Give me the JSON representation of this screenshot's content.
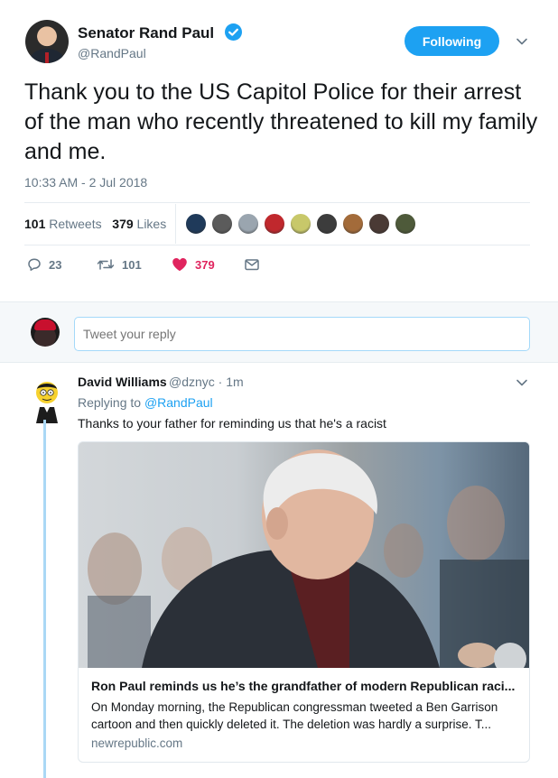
{
  "tweet": {
    "author_name": "Senator Rand Paul",
    "author_handle": "@RandPaul",
    "follow_label": "Following",
    "text": "Thank you to the US Capitol Police for their arrest of the man who recently threatened to kill my family and me.",
    "timestamp": "10:33 AM - 2 Jul 2018",
    "stats": {
      "retweets_count": "101",
      "retweets_label": "Retweets",
      "likes_count": "379",
      "likes_label": "Likes"
    },
    "liker_avatar_colors": [
      "#1f3a5a",
      "#5b5b5b",
      "#9aa5af",
      "#c0282d",
      "#c8c86a",
      "#3c3c3c",
      "#a36b3a",
      "#4a3a35",
      "#4e5a3a"
    ],
    "actions": {
      "replies": "23",
      "retweets": "101",
      "likes": "379"
    }
  },
  "reply_box": {
    "placeholder": "Tweet your reply"
  },
  "reply": {
    "author_name": "David Williams",
    "author_meta": "@dznyc · 1m",
    "replying_prefix": "Replying to",
    "replying_handle": "@RandPaul",
    "text": "Thanks to your father for reminding us that he's a racist",
    "card": {
      "title": "Ron Paul reminds us he’s the grandfather of modern Republican raci...",
      "description": "On Monday morning, the Republican congressman tweeted a Ben Garrison cartoon and then quickly deleted it. The deletion was hardly a surprise. T...",
      "domain": "newrepublic.com"
    }
  },
  "colors": {
    "accent": "#1da1f2",
    "like": "#e0245e",
    "muted": "#657786",
    "text": "#14171a"
  }
}
